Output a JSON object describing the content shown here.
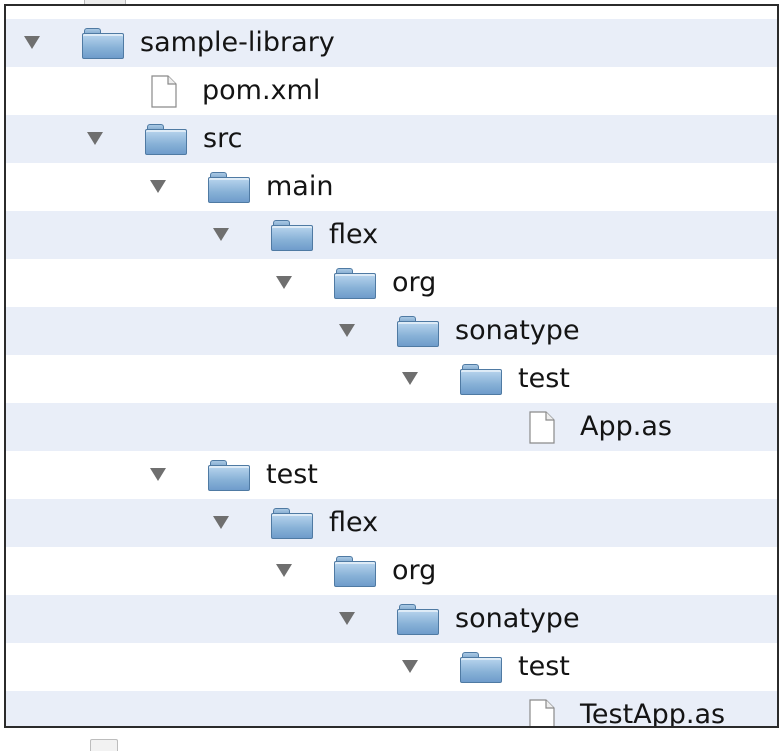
{
  "tree": {
    "rows": [
      {
        "label": "sample-library",
        "kind": "folder",
        "expanded": true,
        "depth": 0,
        "icon": "folder-icon"
      },
      {
        "label": "pom.xml",
        "kind": "file",
        "expanded": false,
        "depth": 1,
        "icon": "file-icon"
      },
      {
        "label": "src",
        "kind": "folder",
        "expanded": true,
        "depth": 1,
        "icon": "folder-icon"
      },
      {
        "label": "main",
        "kind": "folder",
        "expanded": true,
        "depth": 2,
        "icon": "folder-icon"
      },
      {
        "label": "flex",
        "kind": "folder",
        "expanded": true,
        "depth": 3,
        "icon": "folder-icon"
      },
      {
        "label": "org",
        "kind": "folder",
        "expanded": true,
        "depth": 4,
        "icon": "folder-icon"
      },
      {
        "label": "sonatype",
        "kind": "folder",
        "expanded": true,
        "depth": 5,
        "icon": "folder-icon"
      },
      {
        "label": "test",
        "kind": "folder",
        "expanded": true,
        "depth": 6,
        "icon": "folder-icon"
      },
      {
        "label": "App.as",
        "kind": "file",
        "expanded": false,
        "depth": 7,
        "icon": "file-icon"
      },
      {
        "label": "test",
        "kind": "folder",
        "expanded": true,
        "depth": 2,
        "icon": "folder-icon"
      },
      {
        "label": "flex",
        "kind": "folder",
        "expanded": true,
        "depth": 3,
        "icon": "folder-icon"
      },
      {
        "label": "org",
        "kind": "folder",
        "expanded": true,
        "depth": 4,
        "icon": "folder-icon"
      },
      {
        "label": "sonatype",
        "kind": "folder",
        "expanded": true,
        "depth": 5,
        "icon": "folder-icon"
      },
      {
        "label": "test",
        "kind": "folder",
        "expanded": true,
        "depth": 6,
        "icon": "folder-icon"
      },
      {
        "label": "TestApp.as",
        "kind": "file",
        "expanded": false,
        "depth": 7,
        "icon": "file-icon"
      }
    ]
  },
  "colors": {
    "stripe": "#e9eef8",
    "background": "#ffffff",
    "disclosure": "#6f6f6f",
    "folder": "#86b0d6",
    "text": "#141414"
  }
}
